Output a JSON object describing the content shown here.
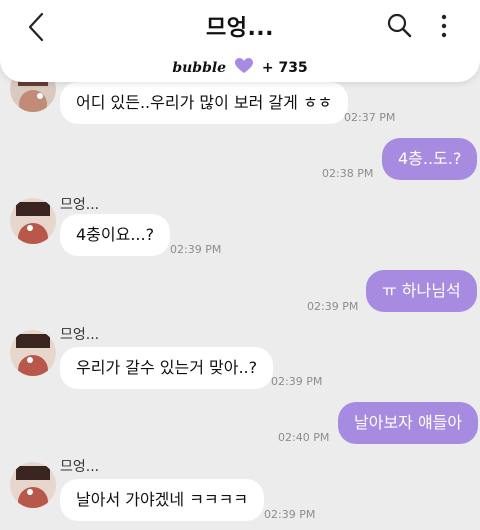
{
  "header": {
    "title": "므엉...",
    "bubble_brand": "bubble",
    "bubble_count": "+ 735",
    "heart_color": "#a78be0"
  },
  "colors": {
    "background": "#ececec",
    "outgoing_bubble": "#a78be0",
    "incoming_bubble": "#ffffff",
    "timestamp": "#8c8c8c"
  },
  "icons": {
    "back": "chevron-left-icon",
    "search": "search-icon",
    "more": "more-vertical-icon",
    "heart": "heart-icon"
  },
  "messages": [
    {
      "dir": "in",
      "text": "어디 있든..우리가 많이 보러 갈게 ㅎㅎ",
      "time": "02:37 PM"
    },
    {
      "dir": "out",
      "text": "4층..도.?",
      "time": "02:38 PM"
    },
    {
      "dir": "in",
      "sender": "므엉...",
      "text": "4충이요...?",
      "time": "02:39 PM"
    },
    {
      "dir": "out",
      "text": "ㅠ 하나님석",
      "time": "02:39 PM"
    },
    {
      "dir": "in",
      "sender": "므엉...",
      "text": "우리가 갈수 있는거 맞아..?",
      "time": "02:39 PM"
    },
    {
      "dir": "out",
      "text": "날아보자 얘들아",
      "time": "02:40 PM"
    },
    {
      "dir": "in",
      "sender": "므엉...",
      "text": "날아서 가야겠네 ㅋㅋㅋㅋ",
      "time": "02:39 PM"
    }
  ]
}
